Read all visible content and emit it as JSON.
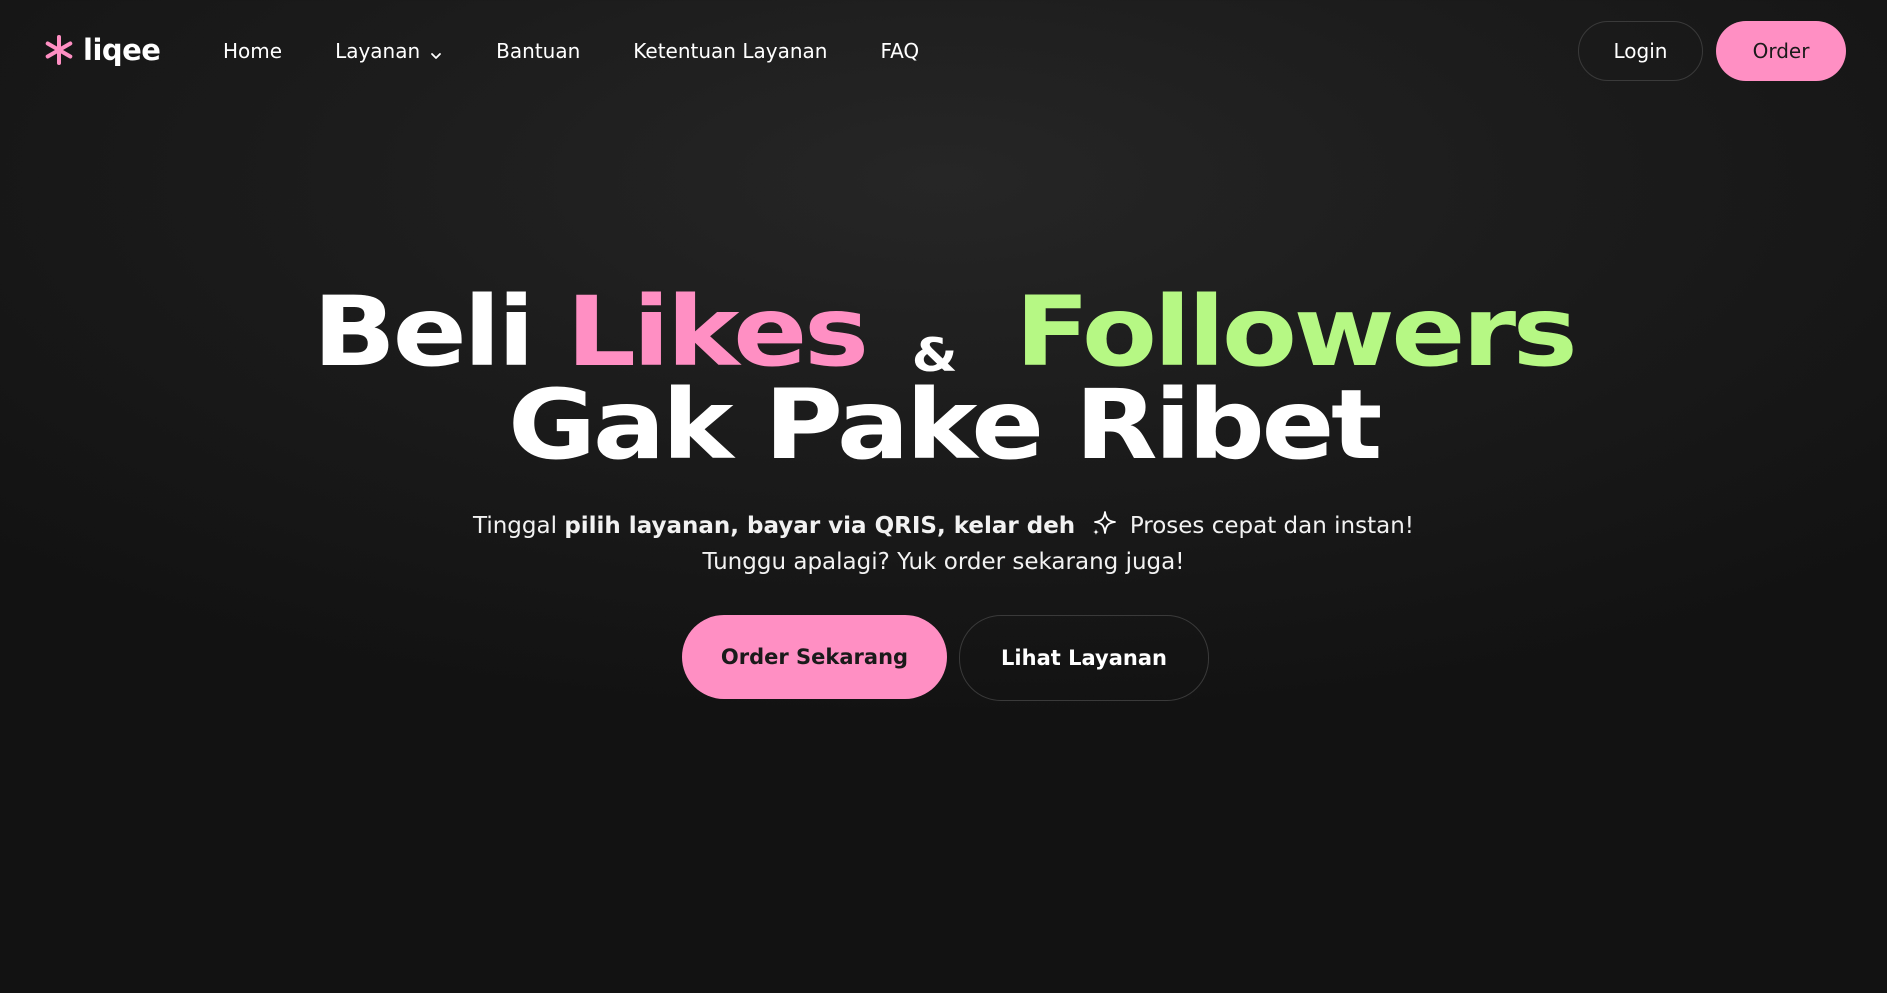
{
  "brand": {
    "name": "liqee",
    "icon": "asterisk-logo-icon",
    "accent_color": "#ff8fc3"
  },
  "nav": {
    "items": [
      {
        "label": "Home",
        "has_dropdown": false
      },
      {
        "label": "Layanan",
        "has_dropdown": true,
        "icon": "chevron-down-icon"
      },
      {
        "label": "Bantuan",
        "has_dropdown": false
      },
      {
        "label": "Ketentuan Layanan",
        "has_dropdown": false
      },
      {
        "label": "FAQ",
        "has_dropdown": false
      }
    ],
    "login_label": "Login",
    "order_label": "Order"
  },
  "hero": {
    "line1": {
      "word1": "Beli",
      "word2": "Likes",
      "amp": "&",
      "word3": "Followers"
    },
    "line2": "Gak Pake Ribet",
    "subtitle": {
      "part1": "Tinggal",
      "bold": "pilih layanan, bayar via QRIS, kelar deh",
      "sparkle_icon": "sparkle-icon",
      "part2": "Proses cepat dan instan!",
      "line2": "Tunggu apalagi? Yuk order sekarang juga!"
    },
    "cta_primary": "Order Sekarang",
    "cta_secondary": "Lihat Layanan"
  },
  "colors": {
    "pink": "#ff8fc3",
    "green": "#b6f884",
    "background": "#1c1c1c",
    "text": "#ffffff"
  }
}
